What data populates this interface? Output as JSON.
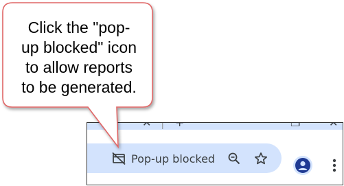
{
  "callout": {
    "lines": [
      "Click the \"pop-",
      "up blocked\" icon",
      "to allow reports",
      "to be generated."
    ],
    "border_color": "#e06666"
  },
  "browser": {
    "tabstrip": {
      "close_glyph": "✕",
      "divider_glyph": "|",
      "new_tab_glyph": "+",
      "restore_glyph": "❐",
      "window_close_glyph": "✕"
    },
    "omnibox": {
      "popup_blocked_label": "Pop-up blocked",
      "popup_blocked_icon": "popup-blocked-icon",
      "zoom_icon": "zoom-out-magnifier-icon",
      "bookmark_icon": "star-outline-icon"
    },
    "profile_icon": "person-avatar-icon",
    "menu_icon": "three-dots-vertical-icon",
    "colors": {
      "omnibox_bg": "#d3e3fd",
      "icon": "#3c4043",
      "profile_bg": "#d3e3fd",
      "profile_fg": "#1f3a93"
    }
  }
}
